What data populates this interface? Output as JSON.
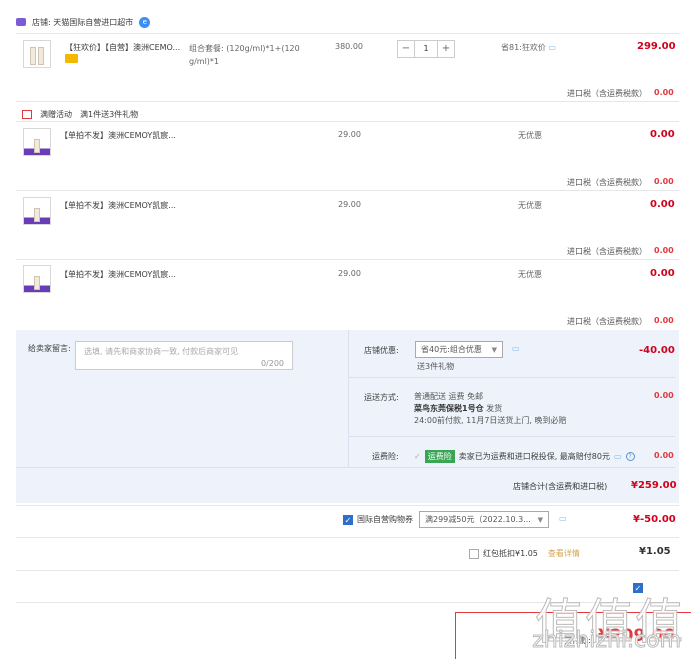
{
  "shop": {
    "label": "店铺: 天猫国际自营进口超市"
  },
  "main_item": {
    "title": "【狂欢价】【自营】澳洲CEMO...",
    "spec": "组合套餐: (120g/ml)*1+(120 g/ml)*1",
    "unit_price": "380.00",
    "quantity": "1",
    "discount": "省81:狂欢价",
    "subtotal": "299.00",
    "tax_label": "进口税（含运费税款）",
    "tax_value": "0.00"
  },
  "promo": {
    "label": "满赠活动",
    "desc": "满1件送3件礼物"
  },
  "gifts": [
    {
      "title": "【单拍不发】澳洲CEMOY凯宸...",
      "price": "29.00",
      "discount": "无优惠",
      "subtotal": "0.00",
      "tax_label": "进口税（含运费税款）",
      "tax_value": "0.00"
    },
    {
      "title": "【单拍不发】澳洲CEMOY凯宸...",
      "price": "29.00",
      "discount": "无优惠",
      "subtotal": "0.00",
      "tax_label": "进口税（含运费税款）",
      "tax_value": "0.00"
    },
    {
      "title": "【单拍不发】澳洲CEMOY凯宸...",
      "price": "29.00",
      "discount": "无优惠",
      "subtotal": "0.00",
      "tax_label": "进口税（含运费税款）",
      "tax_value": "0.00"
    }
  ],
  "message": {
    "label": "给卖家留言:",
    "placeholder": "选填, 请先和商家协商一致, 付款后商家可见",
    "counter": "0/200"
  },
  "shop_discount": {
    "label": "店铺优惠:",
    "selected": "省40元:组合优惠",
    "note": "送3件礼物",
    "value": "-40.00"
  },
  "shipping": {
    "label": "运送方式:",
    "line1": "普通配送 运费 免邮",
    "line2_bold": "菜鸟东莞保税1号仓",
    "line2": "发货",
    "line3": "24:00前付款, 11月7日送货上门, 晚到必赔",
    "value": "0.00"
  },
  "insurance": {
    "label": "运费险:",
    "tag": "运费险",
    "desc": "卖家已为运费和进口税投保, 最高赔付80元",
    "value": "0.00"
  },
  "shop_total": {
    "label": "店铺合计(含运费和进口税)",
    "value": "¥259.00"
  },
  "coupon": {
    "label": "国际自营购物券",
    "selected": "满299减50元（2022.10.3...",
    "value": "¥-50.00"
  },
  "redpacket": {
    "label": "红包抵扣¥1.05",
    "link": "查看详情",
    "value": "¥1.05"
  },
  "footer": {
    "total_label": "实付款:",
    "total_value": "¥209.00"
  },
  "watermark": {
    "text": "值值值",
    "domain": "zhizhizhi.com"
  }
}
